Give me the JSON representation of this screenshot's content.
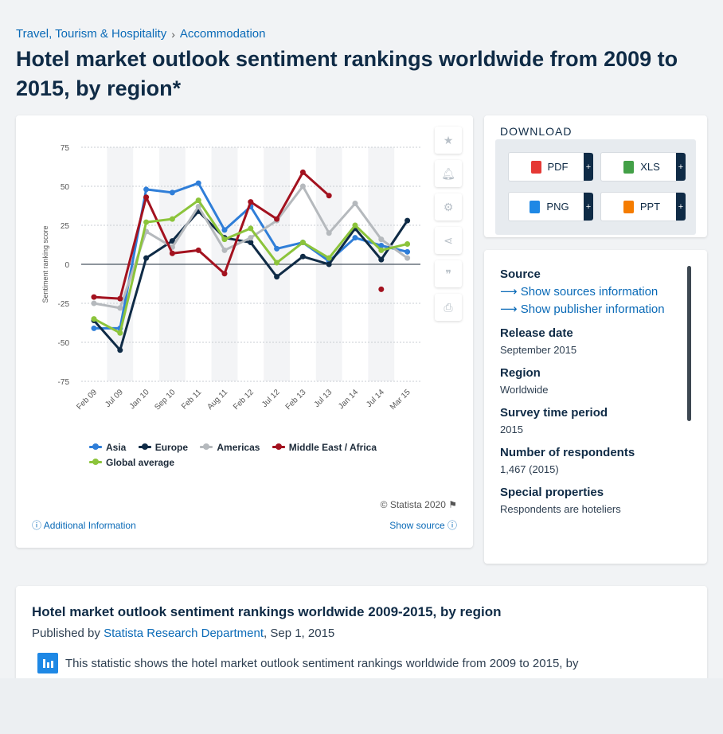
{
  "breadcrumb": {
    "items": [
      "Travel, Tourism & Hospitality",
      "Accommodation"
    ],
    "separator": "›"
  },
  "page_title": "Hotel market outlook sentiment rankings worldwide from 2009 to 2015, by region*",
  "chart_actions": [
    "favorite-star-icon",
    "bell-icon",
    "gear-icon",
    "share-icon",
    "quote-icon",
    "print-icon"
  ],
  "chart_data": {
    "type": "line",
    "title": "",
    "xlabel": "",
    "ylabel": "Sentiment ranking score",
    "ylim": [
      -75,
      75
    ],
    "yticks": [
      75,
      50,
      25,
      0,
      -25,
      -50,
      -75
    ],
    "x": [
      "Feb 09",
      "Jul 09",
      "Jan 10",
      "Sep 10",
      "Feb 11",
      "Aug 11",
      "Feb 12",
      "Jul 12",
      "Feb 13",
      "Jul 13",
      "Jan 14",
      "Jul 14",
      "Mar 15"
    ],
    "x_index_positions": [
      0,
      1,
      2,
      3,
      4,
      5,
      6,
      7,
      8,
      9,
      10,
      11,
      12,
      13
    ],
    "grid": true,
    "legend_position": "bottom",
    "series": [
      {
        "name": "Asia",
        "color": "#2f7ed8",
        "points": [
          [
            0,
            -41
          ],
          [
            1,
            -41
          ],
          [
            2,
            48
          ],
          [
            3,
            46
          ],
          [
            4,
            52
          ],
          [
            5,
            22
          ],
          [
            6,
            37
          ],
          [
            7,
            10
          ],
          [
            8,
            14
          ],
          [
            9,
            2
          ],
          [
            10,
            17
          ],
          [
            11,
            12
          ],
          [
            12,
            8
          ]
        ]
      },
      {
        "name": "Europe",
        "color": "#0f2b46",
        "points": [
          [
            0,
            -36
          ],
          [
            1,
            -55
          ],
          [
            2,
            4
          ],
          [
            3,
            15
          ],
          [
            4,
            34
          ],
          [
            5,
            17
          ],
          [
            6,
            14
          ],
          [
            7,
            -8
          ],
          [
            8,
            5
          ],
          [
            9,
            0
          ],
          [
            10,
            23
          ],
          [
            11,
            3
          ],
          [
            12,
            28
          ]
        ]
      },
      {
        "name": "Americas",
        "color": "#b5b9bd",
        "points": [
          [
            0,
            -25
          ],
          [
            1,
            -28
          ],
          [
            2,
            21
          ],
          [
            3,
            11
          ],
          [
            4,
            37
          ],
          [
            5,
            9
          ],
          [
            6,
            17
          ],
          [
            7,
            28
          ],
          [
            8,
            50
          ],
          [
            9,
            20
          ],
          [
            10,
            39
          ],
          [
            11,
            16
          ],
          [
            12,
            4
          ]
        ]
      },
      {
        "name": "Middle East / Africa",
        "color": "#a3121f",
        "points": [
          [
            0,
            -21
          ],
          [
            1,
            -22
          ],
          [
            2,
            43
          ],
          [
            3,
            7
          ],
          [
            4,
            9
          ],
          [
            5,
            -6
          ],
          [
            6,
            40
          ],
          [
            7,
            29
          ],
          [
            8,
            59
          ],
          [
            9,
            44
          ]
        ],
        "isolated": [
          [
            11,
            -16
          ]
        ]
      },
      {
        "name": "Global average",
        "color": "#8cc43b",
        "points": [
          [
            0,
            -35
          ],
          [
            1,
            -44
          ],
          [
            2,
            27
          ],
          [
            3,
            29
          ],
          [
            4,
            41
          ],
          [
            5,
            16
          ],
          [
            6,
            23
          ],
          [
            7,
            1
          ],
          [
            8,
            14
          ],
          [
            9,
            4
          ],
          [
            10,
            25
          ],
          [
            11,
            9
          ],
          [
            12,
            13
          ]
        ]
      }
    ]
  },
  "copyright": "© Statista 2020",
  "additional_info": "Additional Information",
  "show_source": "Show source",
  "download": {
    "title": "DOWNLOAD",
    "buttons": [
      {
        "label": "PDF",
        "color": "#e53935"
      },
      {
        "label": "XLS",
        "color": "#43a047"
      },
      {
        "label": "PNG",
        "color": "#1e88e5"
      },
      {
        "label": "PPT",
        "color": "#f57c00"
      }
    ],
    "plus": "+"
  },
  "meta": {
    "source_label": "Source",
    "show_sources": "Show sources information",
    "show_publisher": "Show publisher information",
    "release_date_label": "Release date",
    "release_date": "September 2015",
    "region_label": "Region",
    "region": "Worldwide",
    "survey_period_label": "Survey time period",
    "survey_period": "2015",
    "respondents_label": "Number of respondents",
    "respondents": "1,467 (2015)",
    "special_label": "Special properties",
    "special": "Respondents are hoteliers"
  },
  "description": {
    "heading": "Hotel market outlook sentiment rankings worldwide 2009-2015, by region",
    "published_by_prefix": "Published by",
    "publisher": "Statista Research Department",
    "published_date": ", Sep 1, 2015",
    "text": "This statistic shows the hotel market outlook sentiment rankings worldwide from 2009 to 2015, by"
  }
}
